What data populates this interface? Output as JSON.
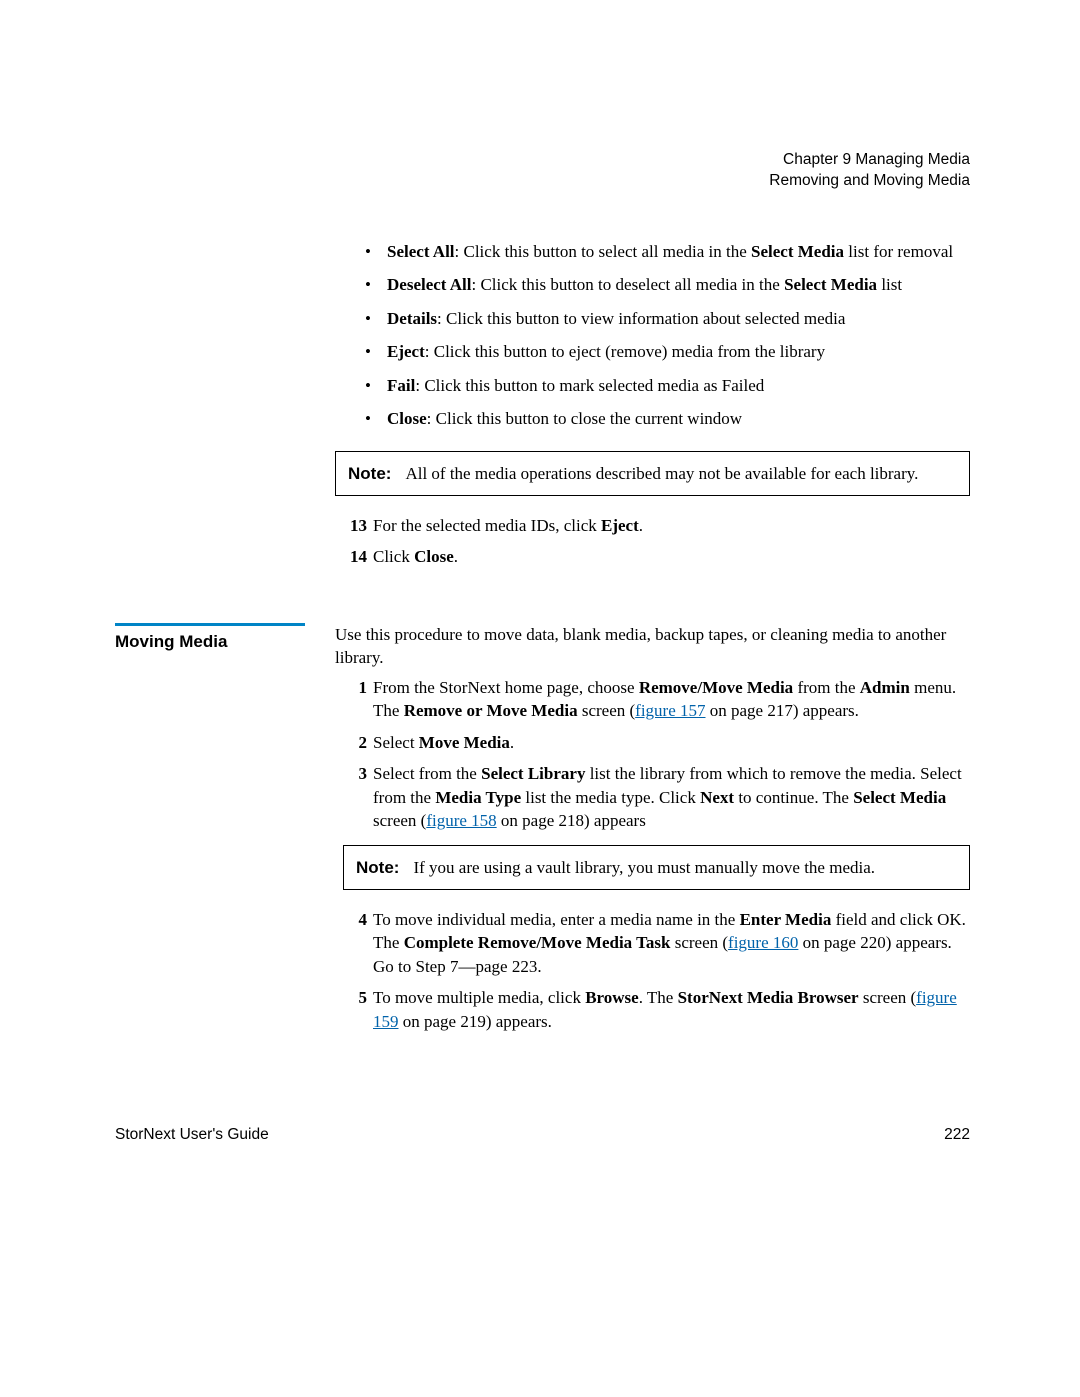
{
  "header": {
    "line1": "Chapter 9  Managing Media",
    "line2": "Removing and Moving Media"
  },
  "bullets": {
    "select_all_b": "Select All",
    "select_all_t1": ": Click this button to select all media in the ",
    "select_all_b2": "Select Media",
    "select_all_t2": " list for removal",
    "deselect_b": "Deselect All",
    "deselect_t1": ": Click this button to deselect all media in the ",
    "deselect_b2": "Select Media",
    "deselect_t2": " list",
    "details_b": "Details",
    "details_t": ": Click this button to view information about selected media",
    "eject_b": "Eject",
    "eject_t": ": Click this button to eject (remove) media from the library",
    "fail_b": "Fail",
    "fail_t": ": Click this button to mark selected media as Failed",
    "close_b": "Close",
    "close_t": ": Click this button to close the current window"
  },
  "note1": {
    "label": "Note:",
    "text": "All of the media operations described may not be available for each library."
  },
  "steps_a": {
    "s13_a": "For the selected media IDs, click ",
    "s13_b": "Eject",
    "s13_c": ".",
    "s14_a": "Click ",
    "s14_b": "Close",
    "s14_c": "."
  },
  "section": "Moving Media",
  "intro": "Use this procedure to move data, blank media, backup tapes, or cleaning media to another library.",
  "steps_b": {
    "s1_a": "From the StorNext home page, choose ",
    "s1_b1": "Remove/Move Media",
    "s1_c": " from the ",
    "s1_b2": "Admin",
    "s1_d": " menu. The ",
    "s1_b3": "Remove or Move Media",
    "s1_e": " screen (",
    "s1_link": "figure 157",
    "s1_f": " on page 217) appears.",
    "s2_a": "Select ",
    "s2_b": "Move Media",
    "s2_c": ".",
    "s3_a": "Select from the ",
    "s3_b1": "Select Library",
    "s3_c": " list the library from which to remove the media. Select from the ",
    "s3_b2": "Media Type",
    "s3_d": " list the media type. Click ",
    "s3_b3": "Next",
    "s3_e": " to continue. The ",
    "s3_b4": "Select Media",
    "s3_f": " screen (",
    "s3_link": "figure 158",
    "s3_g": " on page 218) appears",
    "s4_a": "To move individual media, enter a media name in the ",
    "s4_b1": "Enter Media",
    "s4_c": " field and click OK. The ",
    "s4_b2": "Complete Remove/Move Media Task",
    "s4_d": " screen (",
    "s4_link": "figure 160",
    "s4_e": " on page 220) appears. Go to Step 7—page 223.",
    "s5_a": "To move multiple media, click ",
    "s5_b1": "Browse",
    "s5_c": ". The ",
    "s5_b2": "StorNext Media Browser",
    "s5_d": " screen (",
    "s5_link": "figure 159",
    "s5_e": " on page 219) appears."
  },
  "note2": {
    "label": "Note:",
    "text": "If you are using a vault library, you must manually move the media."
  },
  "footer": {
    "left": "StorNext User's Guide",
    "right": "222"
  }
}
